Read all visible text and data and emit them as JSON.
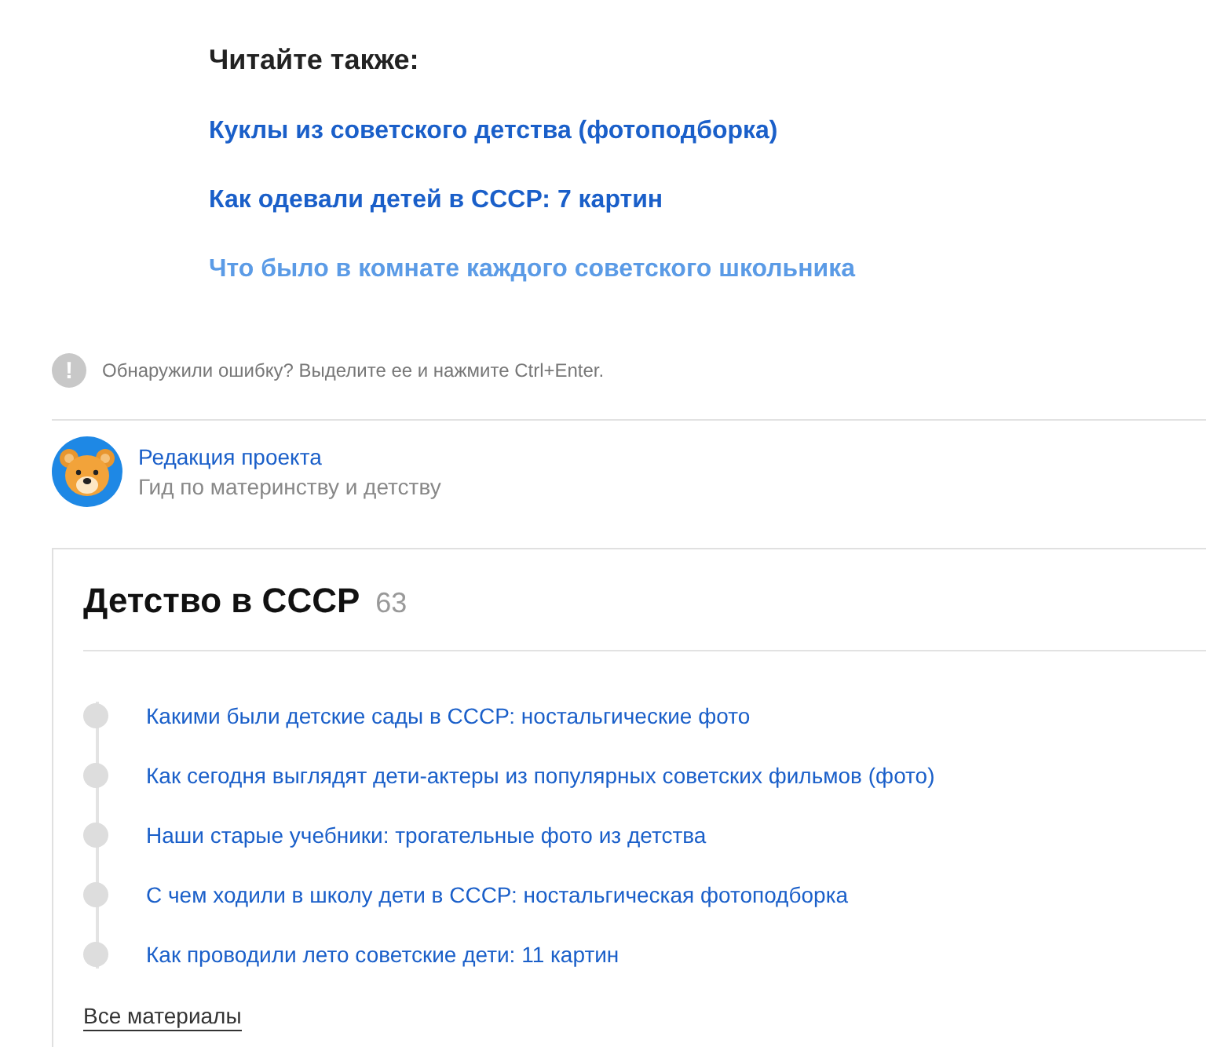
{
  "read_also": {
    "heading": "Читайте также:",
    "links": [
      {
        "text": "Куклы из советского детства (фотоподборка)",
        "hovered": false
      },
      {
        "text": "Как одевали детей в СССР: 7 картин",
        "hovered": false
      },
      {
        "text": "Что было в комнате каждого советского школьника",
        "hovered": true
      }
    ]
  },
  "error_notice": {
    "icon": "!",
    "text": "Обнаружили ошибку? Выделите ее и нажмите Ctrl+Enter."
  },
  "author": {
    "name": "Редакция проекта",
    "description": "Гид по материнству и детству"
  },
  "collection": {
    "title": "Детство в СССР",
    "count": "63",
    "items": [
      "Какими были детские сады в СССР: ностальгические фото",
      "Как сегодня выглядят дети-актеры из популярных советских фильмов (фото)",
      "Наши старые учебники: трогательные фото из детства",
      "С чем ходили в школу дети в СССР: ностальгическая фотоподборка",
      "Как проводили лето советские дети: 11 картин"
    ],
    "all_link": "Все материалы"
  }
}
